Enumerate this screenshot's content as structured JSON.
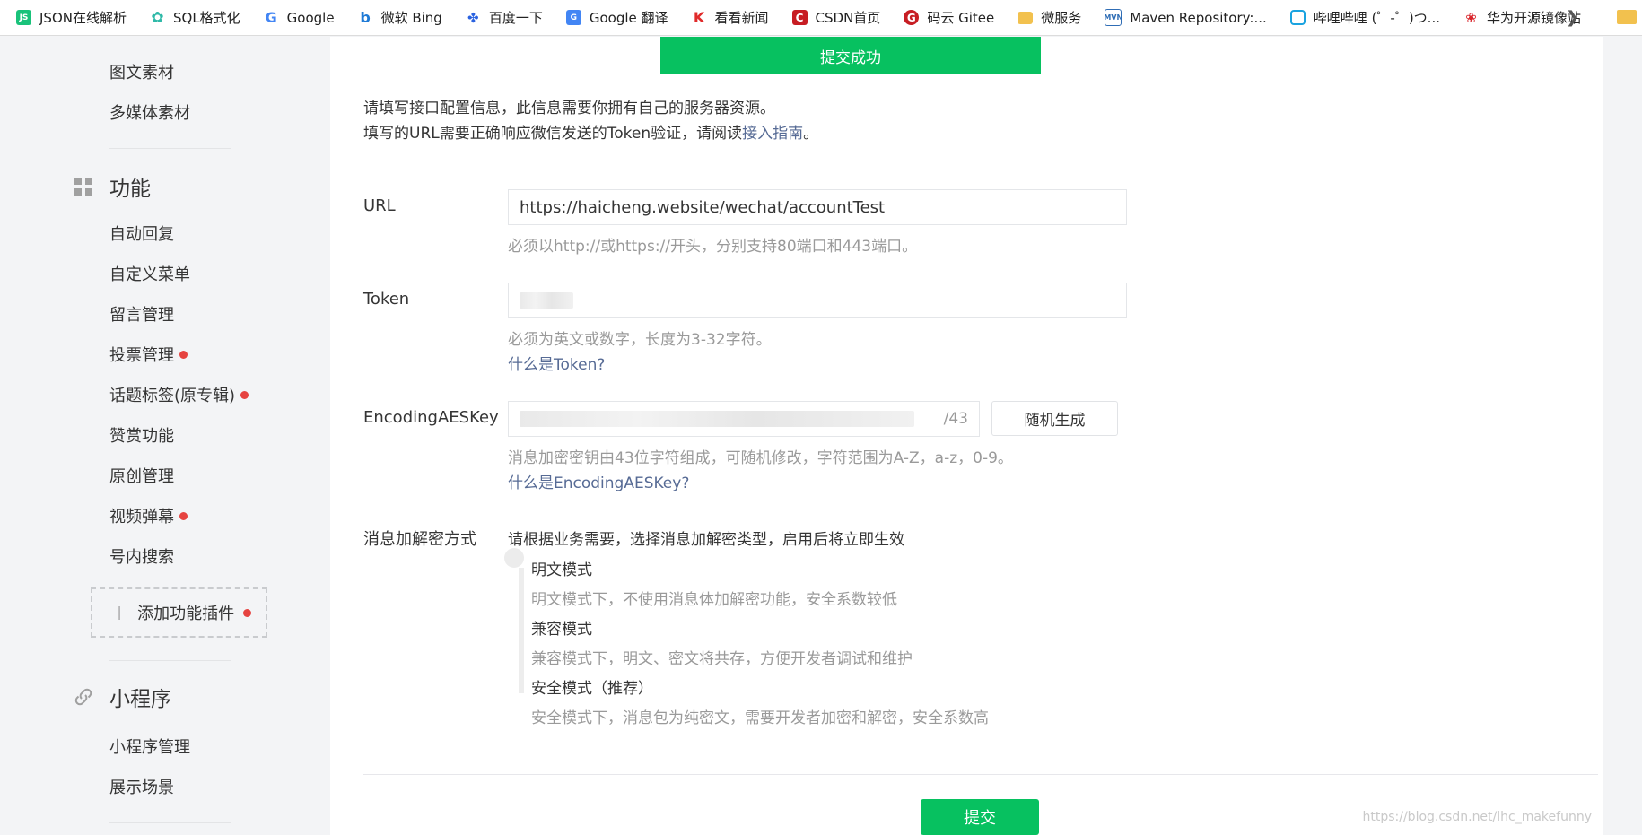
{
  "bookmarks": [
    {
      "label": "JSON在线解析",
      "icon": "json-icon",
      "color": "#19c27a"
    },
    {
      "label": "SQL格式化",
      "icon": "gear-icon",
      "color": "#2fb9a8"
    },
    {
      "label": "Google",
      "icon": "google-icon",
      "color": "#4285f4"
    },
    {
      "label": "微软 Bing",
      "icon": "bing-icon",
      "color": "#1e7ad6"
    },
    {
      "label": "百度一下",
      "icon": "baidu-paw-icon",
      "color": "#2a62e0"
    },
    {
      "label": "Google 翻译",
      "icon": "translate-icon",
      "color": "#4285f4"
    },
    {
      "label": "看看新闻",
      "icon": "news-icon",
      "color": "#e02a2a"
    },
    {
      "label": "CSDN首页",
      "icon": "csdn-icon",
      "color": "#c71d23"
    },
    {
      "label": "码云 Gitee",
      "icon": "gitee-icon",
      "color": "#c71d23"
    },
    {
      "label": "微服务",
      "icon": "folder-icon",
      "color": "#f2c14e"
    },
    {
      "label": "Maven Repository:...",
      "icon": "maven-icon",
      "color": "#2f6db5"
    },
    {
      "label": "哔哩哔哩 (゜-゜)つ...",
      "icon": "bilibili-icon",
      "color": "#1aa3e0"
    },
    {
      "label": "华为开源镜像站",
      "icon": "huawei-icon",
      "color": "#d9262c"
    }
  ],
  "sidebar": {
    "top_items": [
      {
        "label": "图文素材"
      },
      {
        "label": "多媒体素材"
      }
    ],
    "groups": {
      "features": {
        "title": "功能",
        "items": [
          {
            "label": "自动回复",
            "dot": false
          },
          {
            "label": "自定义菜单",
            "dot": false
          },
          {
            "label": "留言管理",
            "dot": false
          },
          {
            "label": "投票管理",
            "dot": true
          },
          {
            "label": "话题标签(原专辑)",
            "dot": true
          },
          {
            "label": "赞赏功能",
            "dot": false
          },
          {
            "label": "原创管理",
            "dot": false
          },
          {
            "label": "视频弹幕",
            "dot": true
          },
          {
            "label": "号内搜索",
            "dot": false
          }
        ],
        "add_plugin": "添加功能插件"
      },
      "miniprogram": {
        "title": "小程序",
        "items": [
          {
            "label": "小程序管理"
          },
          {
            "label": "展示场景"
          }
        ]
      }
    }
  },
  "toast": "提交成功",
  "intro": {
    "line1": "请填写接口配置信息，此信息需要你拥有自己的服务器资源。",
    "line2_prefix": "填写的URL需要正确响应微信发送的Token验证，请阅读",
    "line2_link": "接入指南",
    "line2_suffix": "。"
  },
  "form": {
    "url": {
      "label": "URL",
      "value": "https://haicheng.website/wechat/accountTest",
      "hint": "必须以http://或https://开头，分别支持80端口和443端口。"
    },
    "token": {
      "label": "Token",
      "hint": "必须为英文或数字，长度为3-32字符。",
      "link": "什么是Token?"
    },
    "aes": {
      "label": "EncodingAESKey",
      "counter": "/43",
      "generate_button": "随机生成",
      "hint": "消息加密密钥由43位字符组成，可随机修改，字符范围为A-Z，a-z，0-9。",
      "link": "什么是EncodingAESKey?"
    },
    "encryption": {
      "label": "消息加解密方式",
      "intro": "请根据业务需要，选择消息加解密类型，启用后将立即生效",
      "modes": [
        {
          "title": "明文模式",
          "desc": "明文模式下，不使用消息体加解密功能，安全系数较低"
        },
        {
          "title": "兼容模式",
          "desc": "兼容模式下，明文、密文将共存，方便开发者调试和维护"
        },
        {
          "title": "安全模式（推荐）",
          "desc": "安全模式下，消息包为纯密文，需要开发者加密和解密，安全系数高"
        }
      ]
    },
    "submit_button": "提交"
  },
  "watermark": "https://blog.csdn.net/lhc_makefunny",
  "colors": {
    "accent_green": "#07c160",
    "link_blue": "#576b95",
    "notify_red": "#e64340"
  }
}
